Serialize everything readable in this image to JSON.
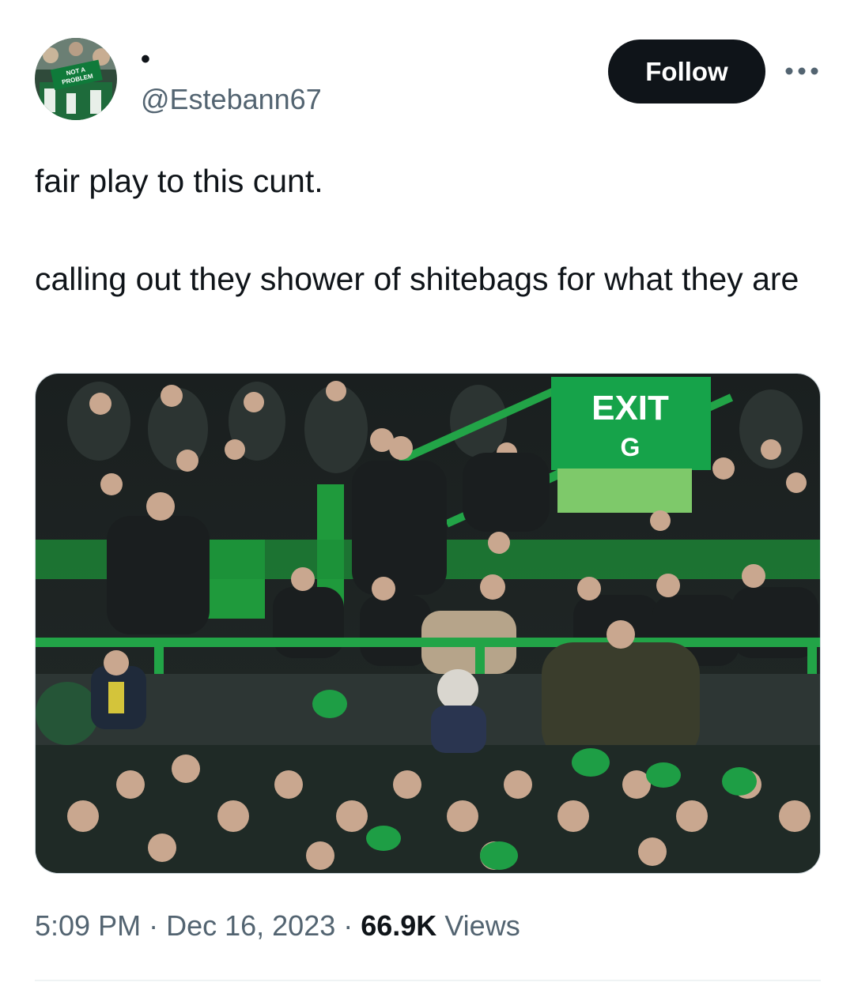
{
  "user": {
    "display_name": "•",
    "handle": "@Estebann67",
    "avatar_banner_line1": "NOT A",
    "avatar_banner_line2": "PROBLEM"
  },
  "follow_button": {
    "label": "Follow"
  },
  "more_button": {
    "icon": "more-horizontal-icon"
  },
  "tweet": {
    "line1": "fair play to this cunt.",
    "line2": "calling out they shower of shitebags for what they are"
  },
  "media": {
    "exit_sign": "EXIT",
    "exit_sign_sub": "G",
    "icon": "photo"
  },
  "meta": {
    "time": "5:09 PM",
    "sep1": " · ",
    "date": "Dec 16, 2023",
    "sep2": " · ",
    "views_count": "66.9K",
    "views_label": " Views"
  },
  "colors": {
    "stand_green": "#1f9a3c",
    "exit_green": "#16a34a",
    "dark_crowd": "#1d2426",
    "follow_bg": "#0f1419",
    "secondary_text": "#536471"
  }
}
